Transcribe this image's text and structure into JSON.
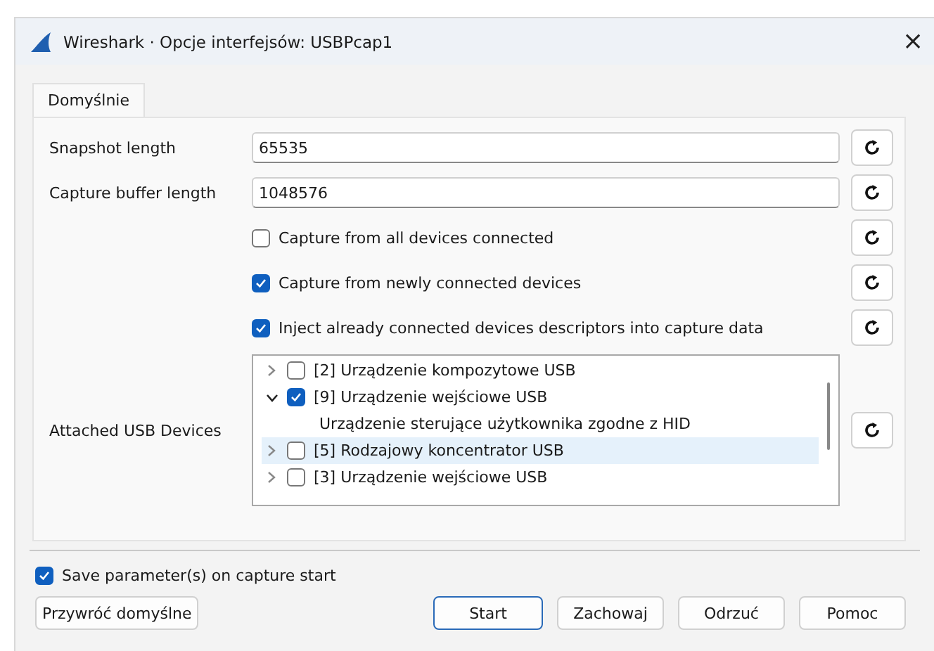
{
  "window": {
    "title": "Wireshark · Opcje interfejsów: USBPcap1",
    "close": "×"
  },
  "tabs": [
    {
      "label": "Domyślnie",
      "selected": true
    }
  ],
  "fields": [
    {
      "label": "Snapshot length",
      "value": "65535"
    },
    {
      "label": "Capture buffer length",
      "value": "1048576"
    }
  ],
  "options": [
    {
      "label": "Capture from all devices connected",
      "checked": false
    },
    {
      "label": "Capture from newly connected devices",
      "checked": true
    },
    {
      "label": "Inject already connected devices descriptors into capture data",
      "checked": true
    }
  ],
  "devices": {
    "label": "Attached USB Devices",
    "items": [
      {
        "label": "[2] Urządzenie kompozytowe USB",
        "checked": false,
        "expanded": false,
        "selected": false
      },
      {
        "label": "[9] Urządzenie wejściowe USB",
        "checked": true,
        "expanded": true,
        "selected": false,
        "children": [
          {
            "label": "Urządzenie sterujące użytkownika zgodne z HID"
          }
        ]
      },
      {
        "label": "[5] Rodzajowy koncentrator USB",
        "checked": false,
        "expanded": false,
        "selected": true
      },
      {
        "label": "[3] Urządzenie wejściowe USB",
        "checked": false,
        "expanded": false,
        "selected": false
      }
    ]
  },
  "save_option": {
    "label": "Save parameter(s) on capture start",
    "checked": true
  },
  "buttons": [
    {
      "label": "Przywróć domyślne",
      "kind": "left",
      "default": false
    },
    {
      "label": "Start",
      "kind": "right",
      "default": true
    },
    {
      "label": "Zachowaj",
      "kind": "right",
      "default": false
    },
    {
      "label": "Odrzuć",
      "kind": "right",
      "default": false
    },
    {
      "label": "Pomoc",
      "kind": "right",
      "default": false
    }
  ]
}
